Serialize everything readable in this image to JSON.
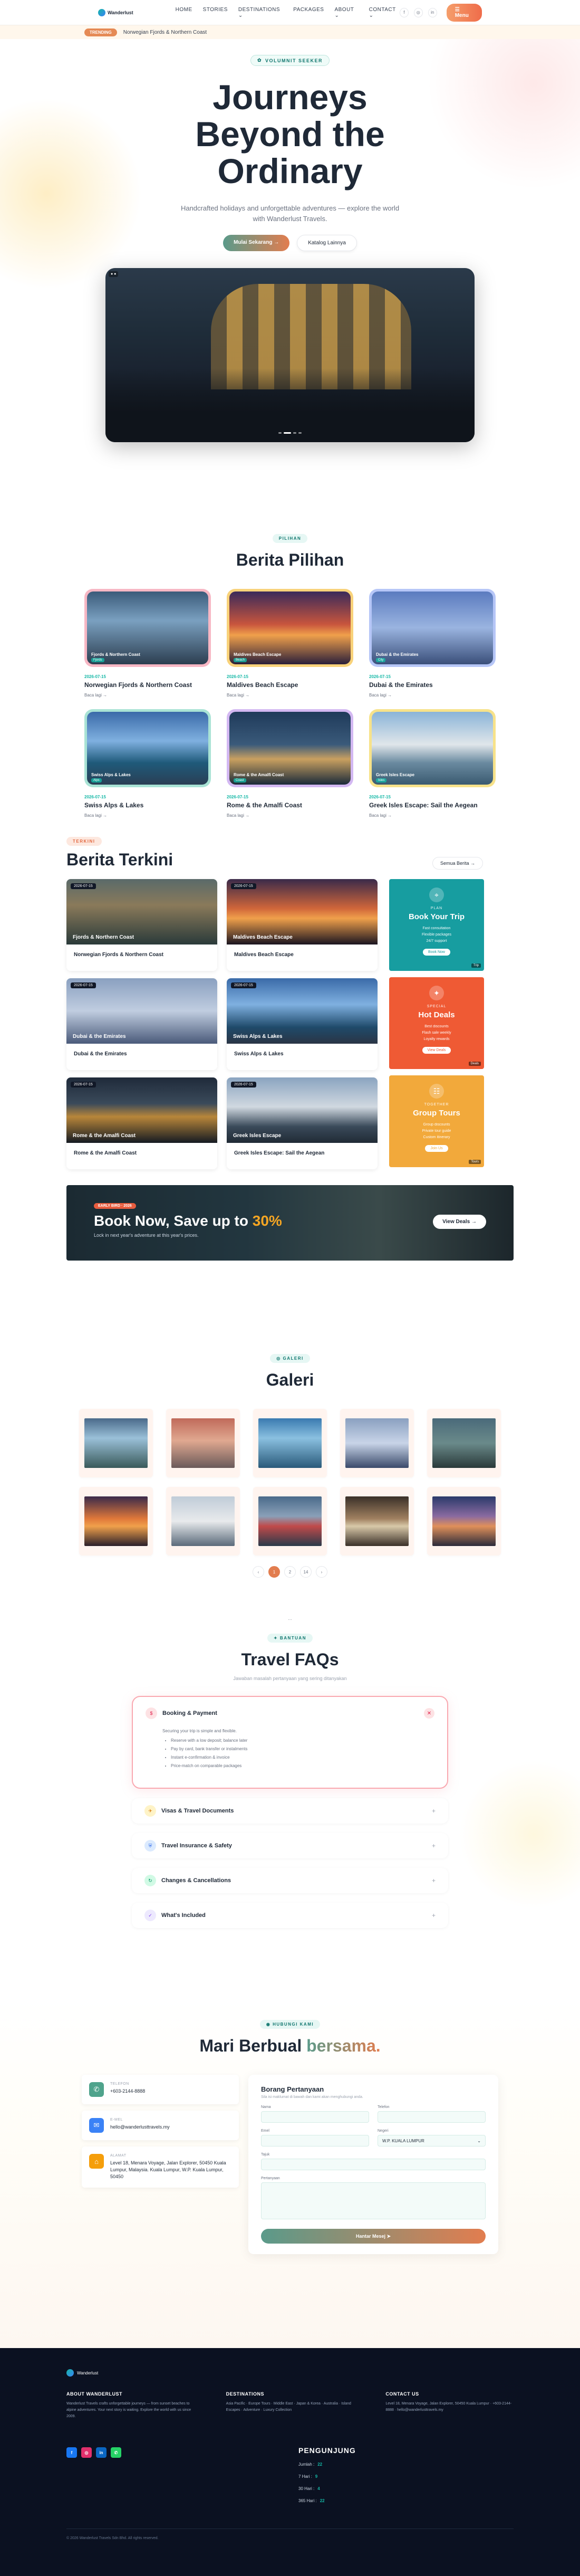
{
  "nav": {
    "brand": "Wanderlust",
    "items": [
      "HOME",
      "STORIES",
      "DESTINATIONS ⌄",
      "PACKAGES",
      "ABOUT ⌄",
      "CONTACT ⌄"
    ],
    "menu_button": "☰ Menu",
    "social": [
      "f",
      "◎",
      "in"
    ]
  },
  "ticker": {
    "tag": "TRENDING",
    "text": "Norwegian Fjords & Northern Coast"
  },
  "hero": {
    "badge": "VOLUMNIT SEEKER",
    "title_line1": "Journeys",
    "title_line2": "Beyond the",
    "title_line3": "Ordinary",
    "subtitle": "Handcrafted holidays and unforgettable adventures — explore the world with Wanderlust Travels.",
    "btn_primary": "Mulai Sekarang →",
    "btn_secondary": "Katalog Lainnya"
  },
  "pilihan": {
    "badge": "PILIHAN",
    "title": "Berita Pilihan",
    "more_label": "Baca lagi →",
    "cards": [
      {
        "date": "2026-07-15",
        "title": "Norwegian Fjords & Northern Coast",
        "overlay": "Fjords & Northern Coast",
        "tag": "Fjords",
        "bg": "linear-gradient(180deg,#3b5b7a 0%,#7aa0c0 40%,#2c3e50 100%)",
        "border": "#f7b7c4"
      },
      {
        "date": "2026-07-15",
        "title": "Maldives Beach Escape",
        "overlay": "Maldives Beach Escape",
        "tag": "Beach",
        "bg": "linear-gradient(180deg,#3a2a5a 0%,#c8553d 45%,#f0a04b 60%,#2a1f3a 100%)",
        "border": "#f8d27a"
      },
      {
        "date": "2026-07-15",
        "title": "Dubai & the Emirates",
        "overlay": "Dubai & the Emirates",
        "tag": "City",
        "bg": "linear-gradient(180deg,#5b7bbf 0%,#9ab4e0 50%,#3a4f7a 100%)",
        "border": "#b6c6f7"
      },
      {
        "date": "2026-07-15",
        "title": "Swiss Alps & Lakes",
        "overlay": "Swiss Alps & Lakes",
        "tag": "Alps",
        "bg": "linear-gradient(180deg,#3a6aa8 0%,#7fb0e0 40%,#1f5a7a 70%,#2a3f55 100%)",
        "border": "#a9e3d5"
      },
      {
        "date": "2026-07-15",
        "title": "Rome & the Amalfi Coast",
        "overlay": "Rome & the Amalfi Coast",
        "tag": "Coast",
        "bg": "linear-gradient(180deg,#1f3a5a 0%,#3a5a7a 45%,#c9a060 65%,#1a2a3a 100%)",
        "border": "#d3b8f2"
      },
      {
        "date": "2026-07-15",
        "title": "Greek Isles Escape: Sail the Aegean",
        "overlay": "Greek Isles Escape",
        "tag": "Isles",
        "bg": "linear-gradient(180deg,#8ab4d8 0%,#e0e6ea 45%,#6a8aa0 70%,#3a5a70 100%)",
        "border": "#f7e28a"
      }
    ]
  },
  "terkini": {
    "badge": "TERKINI",
    "title": "Berita Terkini",
    "btn_all": "Semua Berita →",
    "cards": [
      {
        "date": "2026-07-15",
        "title": "Norwegian Fjords & Northern Coast",
        "overlay": "Fjords & Northern Coast",
        "bg": "linear-gradient(180deg,#5a6a6a 0%,#8a7a5a 40%,#2a3a3a 100%)"
      },
      {
        "date": "2026-07-15",
        "title": "Maldives Beach Escape",
        "overlay": "Maldives Beach Escape",
        "bg": "linear-gradient(180deg,#3a2a4a 0%,#d0663a 45%,#f0a04b 60%,#1a1420 100%)"
      },
      {
        "date": "2026-07-15",
        "title": "Dubai & the Emirates",
        "overlay": "Dubai & the Emirates",
        "bg": "linear-gradient(180deg,#8aa0c0 0%,#c0cde0 50%,#4a5a7a 100%)"
      },
      {
        "date": "2026-07-15",
        "title": "Swiss Alps & Lakes",
        "overlay": "Swiss Alps & Lakes",
        "bg": "linear-gradient(180deg,#3a6aa8 0%,#7fb0e0 40%,#1f4a6a 75%,#2a3545 100%)"
      },
      {
        "date": "2026-07-15",
        "title": "Rome & the Amalfi Coast",
        "overlay": "Rome & the Amalfi Coast",
        "bg": "linear-gradient(180deg,#1f2a3a 0%,#3a4a5a 40%,#b8863a 60%,#141a22 100%)"
      },
      {
        "date": "2026-07-15",
        "title": "Greek Isles Escape: Sail the Aegean",
        "overlay": "Greek Isles Escape",
        "bg": "linear-gradient(180deg,#8aa4c0 0%,#d0d8e0 45%,#3a4a5a 75%,#202a35 100%)"
      }
    ],
    "promos": [
      {
        "icon": "⌖",
        "sub": "PLAN",
        "title": "Book Your Trip",
        "items": [
          "Fast consultation",
          "Flexible packages",
          "24/7 support"
        ],
        "btn": "Book Now",
        "color": "#179da0",
        "corner": "Trip"
      },
      {
        "icon": "✦",
        "sub": "SPECIAL",
        "title": "Hot Deals",
        "items": [
          "Best discounts",
          "Flash sale weekly",
          "Loyalty rewards"
        ],
        "btn": "View Deals",
        "color": "#ef5a34",
        "corner": "Deals"
      },
      {
        "icon": "☷",
        "sub": "TOGETHER",
        "title": "Group Tours",
        "items": [
          "Group discounts",
          "Private tour guide",
          "Custom itinerary"
        ],
        "btn": "Join Us",
        "color": "#f2a93b",
        "corner": "Tours"
      }
    ]
  },
  "banner": {
    "tag": "EARLY BIRD · 2026",
    "title_prefix": "Book Now, Save up to",
    "title_highlight": "30%",
    "subtitle": "Lock in next year's adventure at this year's prices.",
    "button": "View Deals →"
  },
  "galeri": {
    "badge": "◎ GALERI",
    "title": "Galeri",
    "items": [
      "linear-gradient(180deg,#4a6a8a 0%,#9ac0d8 40%,#3a5a5a 100%)",
      "linear-gradient(180deg,#c06a5a 0%,#e0a890 45%,#6a5a5a 100%)",
      "linear-gradient(180deg,#3a7ab0 0%,#8ac0e0 40%,#2a5a7a 100%)",
      "linear-gradient(180deg,#8aa0c0 0%,#c8d4e8 50%,#3a4a6a 100%)",
      "linear-gradient(180deg,#4a6a7a 0%,#6a8a8a 50%,#2a3a3a 100%)",
      "linear-gradient(180deg,#3a2a4a 0%,#e0783a 45%,#f0a04b 60%,#2a1f2a 100%)",
      "linear-gradient(180deg,#c0ccd8 0%,#e8eaec 50%,#5a6a7a 100%)",
      "linear-gradient(180deg,#4a6a8a 0%,#8aa0b8 40%,#c04a4a 60%,#2a3a4a 100%)",
      "linear-gradient(180deg,#3a3028 0%,#a08060 45%,#d8c8a8 60%,#3a3028 100%)",
      "linear-gradient(180deg,#2a3a6a 0%,#8a6aa0 40%,#e0905a 60%,#2a2a3a 100%)"
    ],
    "pages": [
      "‹",
      "1",
      "2",
      "…",
      "14",
      "›"
    ]
  },
  "faq": {
    "badge": "✦ BANTUAN",
    "title": "Travel FAQs",
    "description": "Jawaban masalah pertanyaan yang sering ditanyakan",
    "open": {
      "icon": "$",
      "question": "Booking & Payment",
      "intro": "Securing your trip is simple and flexible.",
      "points": [
        "Reserve with a low deposit; balance later",
        "Pay by card, bank transfer or instalments",
        "Instant e-confirmation & invoice",
        "Price-match on comparable packages"
      ]
    },
    "items": [
      {
        "icon": "✈",
        "question": "Visas & Travel Documents",
        "color": "#fef3c7",
        "fg": "#d97706"
      },
      {
        "icon": "⛨",
        "question": "Travel Insurance & Safety",
        "color": "#dbeafe",
        "fg": "#2563eb"
      },
      {
        "icon": "↻",
        "question": "Changes & Cancellations",
        "color": "#d1fae5",
        "fg": "#059669"
      },
      {
        "icon": "✓",
        "question": "What's Included",
        "color": "#ede9fe",
        "fg": "#7c3aed"
      }
    ]
  },
  "contact": {
    "badge": "◉ HUBUNGI KAMI",
    "title_plain": "Mari Berbual",
    "title_accent": "bersama.",
    "info": [
      {
        "icon": "✆",
        "label": "TELEFON",
        "value": "+603-2144-8888",
        "color": "#4fa38c"
      },
      {
        "icon": "✉",
        "label": "E-MEL",
        "value": "hello@wanderlusttravels.my",
        "color": "#3b82f6"
      },
      {
        "icon": "⌂",
        "label": "ALAMAT",
        "value": "Level 18, Menara Voyage, Jalan Explorer, 50450 Kuala Lumpur, Malaysia. Kuala Lumpur, W.P. Kuala Lumpur, 50450",
        "color": "#f59e0b"
      }
    ],
    "form": {
      "title": "Borang Pertanyaan",
      "description": "Sila isi maklumat di bawah dan kami akan menghubungi anda.",
      "labels": {
        "name": "Nama",
        "phone": "Telefon",
        "email": "Emel",
        "state": "Negeri",
        "title": "Tajuk",
        "message": "Pertanyaan"
      },
      "state_value": "W.P. KUALA LUMPUR",
      "submit": "Hantar Mesej ➤"
    }
  },
  "footer": {
    "brand": "Wanderlust",
    "cols": [
      {
        "title": "ABOUT WANDERLUST",
        "text": "Wanderlust Travels crafts unforgettable journeys — from sunset beaches to alpine adventures. Your next story is waiting. Explore the world with us since 2009."
      },
      {
        "title": "DESTINATIONS",
        "text": "Asia Pacific · Europe Tours · Middle East · Japan & Korea · Australia · Island Escapes · Adventure · Luxury Collection"
      },
      {
        "title": "CONTACT US",
        "text": "Level 18, Menara Voyage, Jalan Explorer, 50450 Kuala Lumpur · +603-2144-8888 · hello@wanderlusttravels.my"
      }
    ],
    "social": [
      {
        "label": "f",
        "color": "#1877f2"
      },
      {
        "label": "◎",
        "color": "#e1306c"
      },
      {
        "label": "in",
        "color": "#0a66c2"
      },
      {
        "label": "✆",
        "color": "#25d366"
      }
    ],
    "visitors_title": "PENGUNJUNG",
    "visitors": [
      {
        "label": "Jumlah :",
        "value": "22"
      },
      {
        "label": "7 Hari :",
        "value": "9"
      },
      {
        "label": "30 Hari :",
        "value": "4"
      },
      {
        "label": "365 Hari :",
        "value": "22"
      }
    ],
    "copyright": "© 2026 Wanderlust Travels Sdn Bhd. All rights reserved."
  }
}
